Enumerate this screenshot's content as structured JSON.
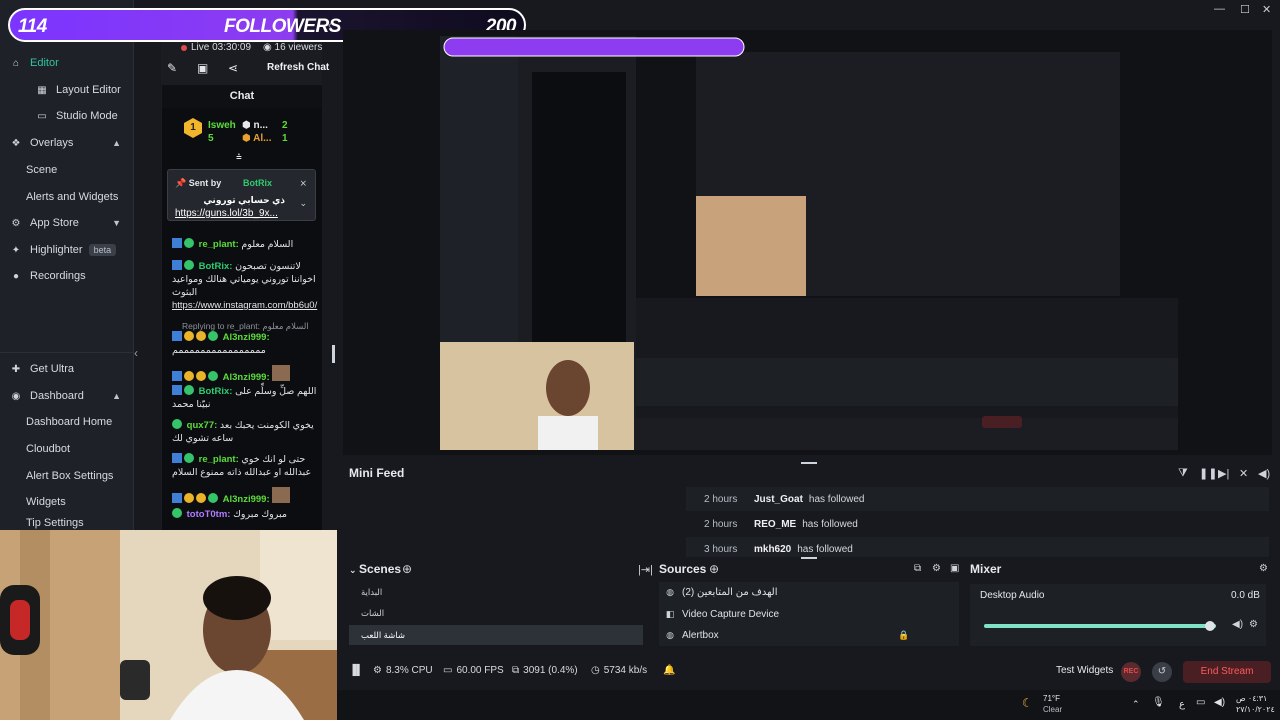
{
  "banner": {
    "count": "114",
    "title": "FOLLOWERS",
    "goal": "200"
  },
  "window": {
    "minimize": "—",
    "maximize": "☐",
    "close": "✕"
  },
  "sidebar": {
    "items": [
      {
        "label": "Editor",
        "icon": "home-icon",
        "active": true
      },
      {
        "label": "Layout Editor",
        "icon": "layout-icon"
      },
      {
        "label": "Studio Mode",
        "icon": "studio-icon"
      },
      {
        "label": "Overlays",
        "icon": "overlays-icon"
      },
      {
        "label": "Scene"
      },
      {
        "label": "Alerts and Widgets"
      },
      {
        "label": "App Store",
        "icon": "store-icon"
      },
      {
        "label": "Highlighter",
        "icon": "highlighter-icon",
        "badge": "beta"
      },
      {
        "label": "Recordings",
        "icon": "record-icon"
      },
      {
        "label": "Get Ultra",
        "icon": "ultra-icon"
      },
      {
        "label": "Dashboard",
        "icon": "dashboard-icon"
      },
      {
        "label": "Dashboard Home"
      },
      {
        "label": "Cloudbot"
      },
      {
        "label": "Alert Box Settings"
      },
      {
        "label": "Widgets"
      },
      {
        "label": "Tip Settings"
      }
    ]
  },
  "chat": {
    "live": "Live 03:30:09",
    "viewers": "16 viewers",
    "refresh": "Refresh Chat",
    "header": "Chat",
    "leaders": [
      {
        "rank": "1",
        "name": "Isweh",
        "score": "5"
      },
      {
        "name": "n...",
        "score": "2"
      },
      {
        "name": "Al...",
        "score": "1"
      }
    ],
    "pinned": {
      "sent_by": "Sent by",
      "user": "BotRix",
      "message": "ذي حسابي توروني",
      "link": "https://guns.lol/3b_9x..."
    },
    "messages": [
      {
        "user": "re_plant:",
        "color": "#5cdc3c",
        "text": "السلام معلوم"
      },
      {
        "user": "BotRix:",
        "color": "#2ecc71",
        "text": "لاتنسون تصبحون اخواننا توروني يومياتي هنالك ومواعيد البثوث",
        "link": "https://www.instagram.com/bb6u0/"
      },
      {
        "reply": "Replying to re_plant: السلام معلوم"
      },
      {
        "user": "Al3nzi999:",
        "color": "#5cdc3c",
        "text": "ممممممممممممممممم"
      },
      {
        "user": "Al3nzi999:",
        "color": "#5cdc3c",
        "text": ""
      },
      {
        "user": "BotRix:",
        "color": "#2ecc71",
        "text": "اللهم صلِّ وسلِّم على نبيّنا محمد"
      },
      {
        "user": "qux77:",
        "color": "#5cdc3c",
        "text": "يخوي الكومنت يحبك بعد ساعه تشوي لك"
      },
      {
        "user": "re_plant:",
        "color": "#5cdc3c",
        "text": "حتى لو انك خوي عبدالله او عبدالله ذاته ممنوع السلام"
      },
      {
        "user": "Al3nzi999:",
        "color": "#5cdc3c",
        "text": ""
      },
      {
        "user": "totoT0tm:",
        "color": "#b07cff",
        "text": "مبروك مبروك"
      }
    ]
  },
  "mini_feed": {
    "title": "Mini Feed",
    "rows": [
      {
        "time": "2 hours",
        "name": "Just_Goat",
        "action": "has followed"
      },
      {
        "time": "2 hours",
        "name": "REO_ME",
        "action": "has followed"
      },
      {
        "time": "3 hours",
        "name": "mkh620",
        "action": "has followed"
      }
    ]
  },
  "scenes": {
    "title": "Scenes",
    "items": [
      "البداية",
      "الشات",
      "شاشة اللعب"
    ]
  },
  "sources": {
    "title": "Sources",
    "items": [
      {
        "label": "الهدف من المتابعين (2)",
        "icon": "globe-icon"
      },
      {
        "label": "Video Capture Device",
        "icon": "camera-icon"
      },
      {
        "label": "Alertbox",
        "icon": "globe-icon"
      }
    ]
  },
  "mixer": {
    "title": "Mixer",
    "track": "Desktop Audio",
    "level": "0.0 dB",
    "slider_fraction": 1.0
  },
  "status": {
    "cpu": "8.3% CPU",
    "fps": "60.00 FPS",
    "dropped": "3091 (0.4%)",
    "bitrate": "5734 kb/s",
    "test_widgets": "Test Widgets",
    "rec": "REC",
    "end_stream": "End Stream"
  },
  "taskbar": {
    "temp": "71°F",
    "weather": "Clear",
    "lang": "ع",
    "time": "٠٤:٣١ ص",
    "date": "٢٧/١٠/٢٠٢٤"
  },
  "colors": {
    "accent": "#31c3a2",
    "banner_purple": "#8d3cf0",
    "danger": "#ff5a5a"
  }
}
